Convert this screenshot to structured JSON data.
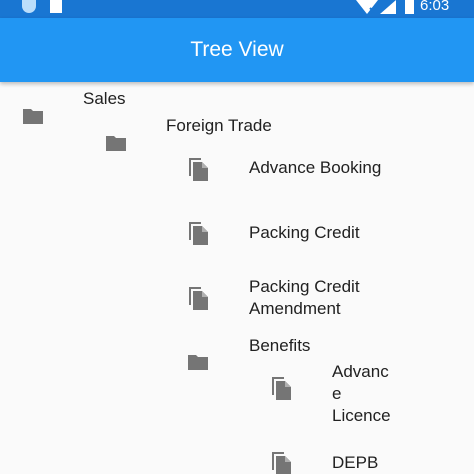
{
  "status_bar": {
    "time": "6:03",
    "icons": [
      "circle-icon",
      "sd-card-icon",
      "wifi-off-icon",
      "signal-icon",
      "battery-icon"
    ]
  },
  "app_bar": {
    "title": "Tree View"
  },
  "tree": [
    {
      "label": "Sales",
      "type": "folder"
    },
    {
      "label": "Foreign Trade",
      "type": "folder"
    },
    {
      "label": "Advance Booking",
      "type": "file"
    },
    {
      "label": "Packing Credit",
      "type": "file"
    },
    {
      "label": "Packing Credit\nAmendment",
      "type": "file"
    },
    {
      "label": "Benefits",
      "type": "folder"
    },
    {
      "label": "Advanc\ne\nLicence",
      "type": "file"
    },
    {
      "label": "DEPB",
      "type": "file"
    }
  ],
  "colors": {
    "status_bar": "#1976d2",
    "app_bar": "#2196f3",
    "icon": "#757575",
    "text": "#212121"
  }
}
